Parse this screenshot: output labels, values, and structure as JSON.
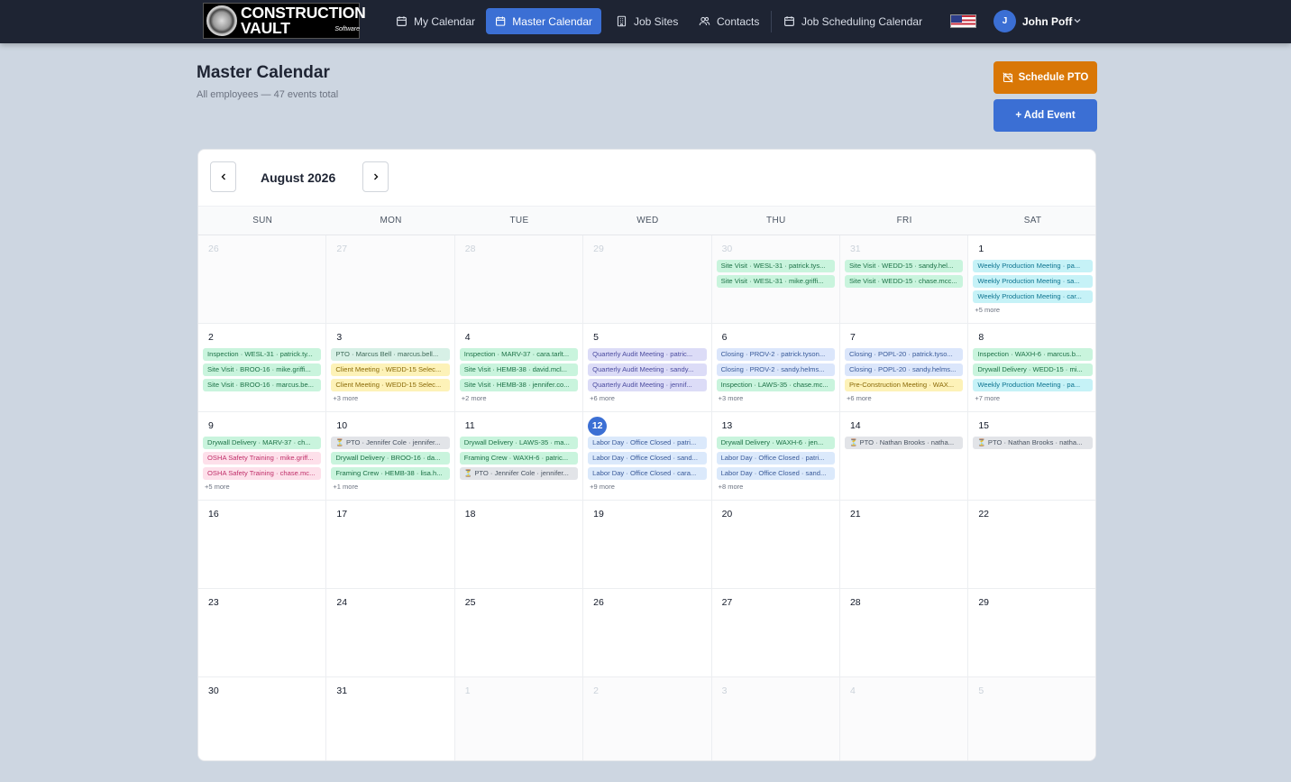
{
  "app": {
    "logo_line1": "CONSTRUCTION",
    "logo_line2": "VAULT",
    "logo_tag": "Software"
  },
  "nav": {
    "my_calendar": "My Calendar",
    "master_calendar": "Master Calendar",
    "job_sites": "Job Sites",
    "contacts": "Contacts",
    "job_scheduling": "Job Scheduling Calendar"
  },
  "user": {
    "initial": "J",
    "name": "John Poff"
  },
  "page": {
    "title": "Master Calendar",
    "subtitle": "All employees — 47 events total",
    "schedule_pto": "Schedule PTO",
    "add_event": "+ Add Event"
  },
  "calendar": {
    "month_label": "August 2026",
    "weekdays": [
      "SUN",
      "MON",
      "TUE",
      "WED",
      "THU",
      "FRI",
      "SAT"
    ],
    "days": [
      {
        "num": "26",
        "other": true,
        "events": [],
        "more": ""
      },
      {
        "num": "27",
        "other": true,
        "events": [],
        "more": ""
      },
      {
        "num": "28",
        "other": true,
        "events": [],
        "more": ""
      },
      {
        "num": "29",
        "other": true,
        "events": [],
        "more": ""
      },
      {
        "num": "30",
        "other": true,
        "events": [
          {
            "t": "Site Visit · WESL-31 · patrick.tys...",
            "c": "site"
          },
          {
            "t": "Site Visit · WESL-31 · mike.griffi...",
            "c": "site"
          }
        ],
        "more": ""
      },
      {
        "num": "31",
        "other": true,
        "events": [
          {
            "t": "Site Visit · WEDD-15 · sandy.hel...",
            "c": "site"
          },
          {
            "t": "Site Visit · WEDD-15 · chase.mcc...",
            "c": "site"
          }
        ],
        "more": ""
      },
      {
        "num": "1",
        "other": false,
        "events": [
          {
            "t": "Weekly Production Meeting · pa...",
            "c": "weekly"
          },
          {
            "t": "Weekly Production Meeting · sa...",
            "c": "weekly"
          },
          {
            "t": "Weekly Production Meeting · car...",
            "c": "weekly"
          }
        ],
        "more": "+5 more"
      },
      {
        "num": "2",
        "other": false,
        "events": [
          {
            "t": "Inspection · WESL-31 · patrick.ty...",
            "c": "insp"
          },
          {
            "t": "Site Visit · BROO-16 · mike.griffi...",
            "c": "site"
          },
          {
            "t": "Site Visit · BROO-16 · marcus.be...",
            "c": "site"
          }
        ],
        "more": ""
      },
      {
        "num": "3",
        "other": false,
        "events": [
          {
            "t": "PTO · Marcus Bell · marcus.bell...",
            "c": "pto"
          },
          {
            "t": "Client Meeting · WEDD-15 Selec...",
            "c": "client"
          },
          {
            "t": "Client Meeting · WEDD-15 Selec...",
            "c": "client"
          }
        ],
        "more": "+3 more"
      },
      {
        "num": "4",
        "other": false,
        "events": [
          {
            "t": "Inspection · MARV-37 · cara.tarlt...",
            "c": "insp"
          },
          {
            "t": "Site Visit · HEMB-38 · david.mcl...",
            "c": "site"
          },
          {
            "t": "Site Visit · HEMB-38 · jennifer.co...",
            "c": "site"
          }
        ],
        "more": "+2 more"
      },
      {
        "num": "5",
        "other": false,
        "events": [
          {
            "t": "Quarterly Audit Meeting · patric...",
            "c": "audit"
          },
          {
            "t": "Quarterly Audit Meeting · sandy...",
            "c": "audit"
          },
          {
            "t": "Quarterly Audit Meeting · jennif...",
            "c": "audit"
          }
        ],
        "more": "+6 more"
      },
      {
        "num": "6",
        "other": false,
        "events": [
          {
            "t": "Closing · PROV-2 · patrick.tyson...",
            "c": "closing"
          },
          {
            "t": "Closing · PROV-2 · sandy.helms...",
            "c": "closing"
          },
          {
            "t": "Inspection · LAWS-35 · chase.mc...",
            "c": "insp"
          }
        ],
        "more": "+3 more"
      },
      {
        "num": "7",
        "other": false,
        "events": [
          {
            "t": "Closing · POPL-20 · patrick.tyso...",
            "c": "closing"
          },
          {
            "t": "Closing · POPL-20 · sandy.helms...",
            "c": "closing"
          },
          {
            "t": "Pre-Construction Meeting · WAX...",
            "c": "precon"
          }
        ],
        "more": "+6 more"
      },
      {
        "num": "8",
        "other": false,
        "events": [
          {
            "t": "Inspection · WAXH-6 · marcus.b...",
            "c": "insp"
          },
          {
            "t": "Drywall Delivery · WEDD-15 · mi...",
            "c": "site"
          },
          {
            "t": "Weekly Production Meeting · pa...",
            "c": "weekly"
          }
        ],
        "more": "+7 more"
      },
      {
        "num": "9",
        "other": false,
        "events": [
          {
            "t": "Drywall Delivery · MARV-37 · ch...",
            "c": "site"
          },
          {
            "t": "OSHA Safety Training · mike.griff...",
            "c": "osha"
          },
          {
            "t": "OSHA Safety Training · chase.mc...",
            "c": "osha"
          }
        ],
        "more": "+5 more"
      },
      {
        "num": "10",
        "other": false,
        "events": [
          {
            "t": "⏳ PTO · Jennifer Cole · jennifer...",
            "c": "grey"
          },
          {
            "t": "Drywall Delivery · BROO-16 · da...",
            "c": "site"
          },
          {
            "t": "Framing Crew · HEMB-38 · lisa.h...",
            "c": "site"
          }
        ],
        "more": "+1 more"
      },
      {
        "num": "11",
        "other": false,
        "events": [
          {
            "t": "Drywall Delivery · LAWS-35 · ma...",
            "c": "site"
          },
          {
            "t": "Framing Crew · WAXH-6 · patric...",
            "c": "site"
          },
          {
            "t": "⏳ PTO · Jennifer Cole · jennifer...",
            "c": "grey"
          }
        ],
        "more": ""
      },
      {
        "num": "12",
        "other": false,
        "today": true,
        "events": [
          {
            "t": "Labor Day · Office Closed · patri...",
            "c": "labor"
          },
          {
            "t": "Labor Day · Office Closed · sand...",
            "c": "labor"
          },
          {
            "t": "Labor Day · Office Closed · cara...",
            "c": "labor"
          }
        ],
        "more": "+9 more"
      },
      {
        "num": "13",
        "other": false,
        "events": [
          {
            "t": "Drywall Delivery · WAXH-6 · jen...",
            "c": "site"
          },
          {
            "t": "Labor Day · Office Closed · patri...",
            "c": "labor"
          },
          {
            "t": "Labor Day · Office Closed · sand...",
            "c": "labor"
          }
        ],
        "more": "+8 more"
      },
      {
        "num": "14",
        "other": false,
        "events": [
          {
            "t": "⏳ PTO · Nathan Brooks · natha...",
            "c": "grey"
          }
        ],
        "more": ""
      },
      {
        "num": "15",
        "other": false,
        "events": [
          {
            "t": "⏳ PTO · Nathan Brooks · natha...",
            "c": "grey"
          }
        ],
        "more": ""
      },
      {
        "num": "16",
        "other": false,
        "events": [],
        "more": ""
      },
      {
        "num": "17",
        "other": false,
        "events": [],
        "more": ""
      },
      {
        "num": "18",
        "other": false,
        "events": [],
        "more": ""
      },
      {
        "num": "19",
        "other": false,
        "events": [],
        "more": ""
      },
      {
        "num": "20",
        "other": false,
        "events": [],
        "more": ""
      },
      {
        "num": "21",
        "other": false,
        "events": [],
        "more": ""
      },
      {
        "num": "22",
        "other": false,
        "events": [],
        "more": ""
      },
      {
        "num": "23",
        "other": false,
        "events": [],
        "more": ""
      },
      {
        "num": "24",
        "other": false,
        "events": [],
        "more": ""
      },
      {
        "num": "25",
        "other": false,
        "events": [],
        "more": ""
      },
      {
        "num": "26",
        "other": false,
        "events": [],
        "more": ""
      },
      {
        "num": "27",
        "other": false,
        "events": [],
        "more": ""
      },
      {
        "num": "28",
        "other": false,
        "events": [],
        "more": ""
      },
      {
        "num": "29",
        "other": false,
        "events": [],
        "more": ""
      },
      {
        "num": "30",
        "other": false,
        "events": [],
        "more": ""
      },
      {
        "num": "31",
        "other": false,
        "events": [],
        "more": ""
      },
      {
        "num": "1",
        "other": true,
        "events": [],
        "more": ""
      },
      {
        "num": "2",
        "other": true,
        "events": [],
        "more": ""
      },
      {
        "num": "3",
        "other": true,
        "events": [],
        "more": ""
      },
      {
        "num": "4",
        "other": true,
        "events": [],
        "more": ""
      },
      {
        "num": "5",
        "other": true,
        "events": [],
        "more": ""
      }
    ]
  }
}
